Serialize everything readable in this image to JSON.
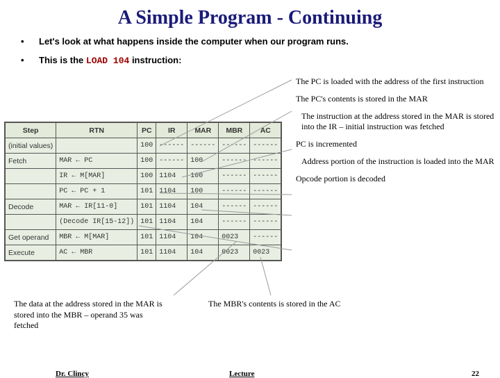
{
  "title": "A Simple Program - Continuing",
  "bullets": {
    "b1": "Let's look at what happens inside the computer when our program runs.",
    "b2_prefix": "This is the ",
    "b2_code": "LOAD 104",
    "b2_suffix": " instruction:"
  },
  "table": {
    "headers": [
      "Step",
      "RTN",
      "PC",
      "IR",
      "MAR",
      "MBR",
      "AC"
    ],
    "rows": [
      {
        "step": "(initial values)",
        "rtn": "",
        "pc": "100",
        "ir": "------",
        "mar": "------",
        "mbr": "------",
        "ac": "------"
      },
      {
        "step": "Fetch",
        "rtn": "MAR ← PC",
        "pc": "100",
        "ir": "------",
        "mar": "100",
        "mbr": "------",
        "ac": "------"
      },
      {
        "step": "",
        "rtn": "IR ← M[MAR]",
        "pc": "100",
        "ir": "1104",
        "mar": "100",
        "mbr": "------",
        "ac": "------"
      },
      {
        "step": "",
        "rtn": "PC ← PC + 1",
        "pc": "101",
        "ir": "1104",
        "mar": "100",
        "mbr": "------",
        "ac": "------"
      },
      {
        "step": "Decode",
        "rtn": "MAR ← IR[11-0]",
        "pc": "101",
        "ir": "1104",
        "mar": "104",
        "mbr": "------",
        "ac": "------"
      },
      {
        "step": "",
        "rtn": "(Decode IR[15-12])",
        "pc": "101",
        "ir": "1104",
        "mar": "104",
        "mbr": "------",
        "ac": "------"
      },
      {
        "step": "Get operand",
        "rtn": "MBR ← M[MAR]",
        "pc": "101",
        "ir": "1104",
        "mar": "104",
        "mbr": "0023",
        "ac": "------"
      },
      {
        "step": "Execute",
        "rtn": "AC ← MBR",
        "pc": "101",
        "ir": "1104",
        "mar": "104",
        "mbr": "0023",
        "ac": "0023"
      }
    ]
  },
  "annotations": {
    "a1": "The PC is loaded with the address of the first instruction",
    "a2": "The PC's contents is stored in the MAR",
    "a3": "The instruction at the address stored in the MAR is stored into the IR – initial instruction was fetched",
    "a4": "PC is incremented",
    "a5": "Address portion of the instruction is loaded into the MAR",
    "a6": "Opcode portion is decoded"
  },
  "lower_notes": {
    "left": "The data at the address stored in the MAR is stored into the MBR – operand 35 was fetched",
    "right": "The MBR's contents is stored in the AC"
  },
  "footer": {
    "left": "Dr. Clincy",
    "center": "Lecture",
    "right": "22"
  },
  "chart_data": {
    "type": "table",
    "title": "A Simple Program - Continuing (LOAD 104 instruction trace)",
    "columns": [
      "Step",
      "RTN",
      "PC",
      "IR",
      "MAR",
      "MBR",
      "AC"
    ],
    "rows": [
      [
        "(initial values)",
        "",
        "100",
        "------",
        "------",
        "------",
        "------"
      ],
      [
        "Fetch",
        "MAR ← PC",
        "100",
        "------",
        "100",
        "------",
        "------"
      ],
      [
        "",
        "IR ← M[MAR]",
        "100",
        "1104",
        "100",
        "------",
        "------"
      ],
      [
        "",
        "PC ← PC + 1",
        "101",
        "1104",
        "100",
        "------",
        "------"
      ],
      [
        "Decode",
        "MAR ← IR[11-0]",
        "101",
        "1104",
        "104",
        "------",
        "------"
      ],
      [
        "",
        "(Decode IR[15-12])",
        "101",
        "1104",
        "104",
        "------",
        "------"
      ],
      [
        "Get operand",
        "MBR ← M[MAR]",
        "101",
        "1104",
        "104",
        "0023",
        "------"
      ],
      [
        "Execute",
        "AC ← MBR",
        "101",
        "1104",
        "104",
        "0023",
        "0023"
      ]
    ]
  }
}
